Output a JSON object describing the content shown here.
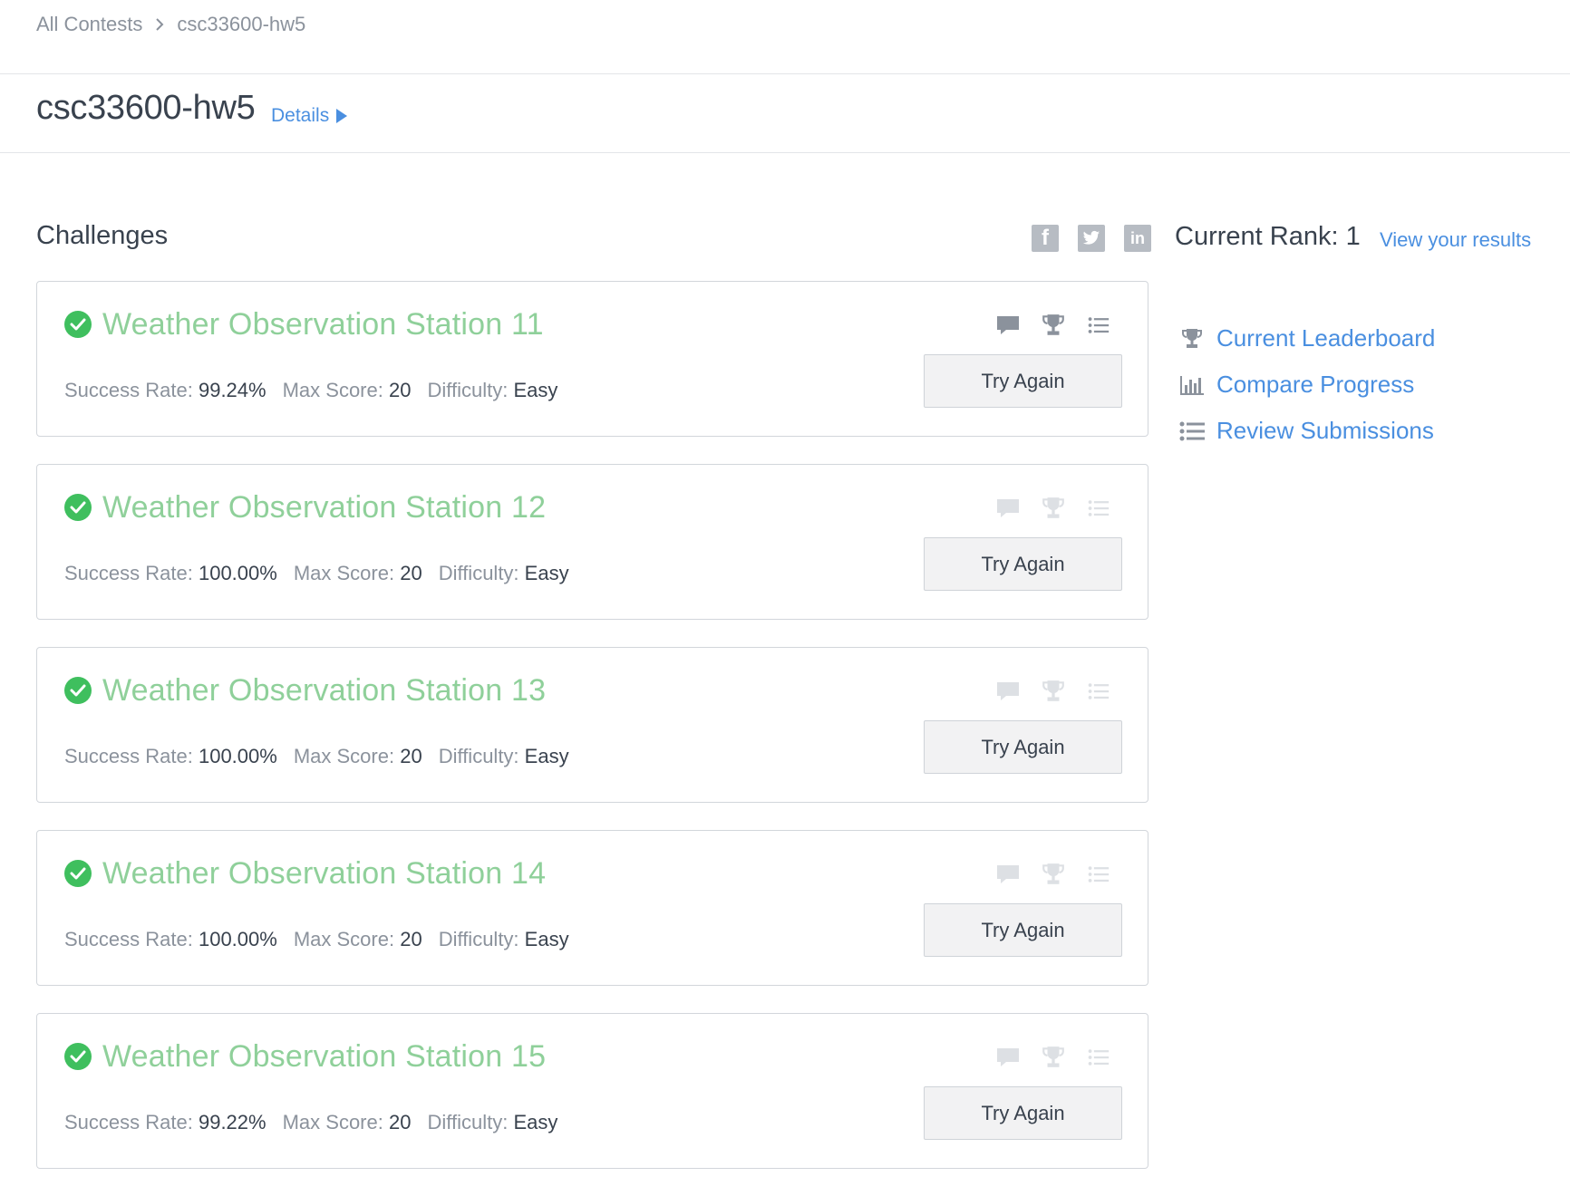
{
  "breadcrumb": {
    "root": "All Contests",
    "current": "csc33600-hw5"
  },
  "header": {
    "title": "csc33600-hw5",
    "details_label": "Details"
  },
  "challenges": {
    "heading": "Challenges",
    "rank_label": "Current Rank: 1",
    "view_results_label": "View your results",
    "items": [
      {
        "title": "Weather Observation Station 11",
        "success_label": "Success Rate:",
        "success_rate": "99.24%",
        "max_label": "Max Score:",
        "max_score": "20",
        "difficulty_label": "Difficulty:",
        "difficulty": "Easy",
        "button_label": "Try Again",
        "icons_active": true
      },
      {
        "title": "Weather Observation Station 12",
        "success_label": "Success Rate:",
        "success_rate": "100.00%",
        "max_label": "Max Score:",
        "max_score": "20",
        "difficulty_label": "Difficulty:",
        "difficulty": "Easy",
        "button_label": "Try Again",
        "icons_active": false
      },
      {
        "title": "Weather Observation Station 13",
        "success_label": "Success Rate:",
        "success_rate": "100.00%",
        "max_label": "Max Score:",
        "max_score": "20",
        "difficulty_label": "Difficulty:",
        "difficulty": "Easy",
        "button_label": "Try Again",
        "icons_active": false
      },
      {
        "title": "Weather Observation Station 14",
        "success_label": "Success Rate:",
        "success_rate": "100.00%",
        "max_label": "Max Score:",
        "max_score": "20",
        "difficulty_label": "Difficulty:",
        "difficulty": "Easy",
        "button_label": "Try Again",
        "icons_active": false
      },
      {
        "title": "Weather Observation Station 15",
        "success_label": "Success Rate:",
        "success_rate": "99.22%",
        "max_label": "Max Score:",
        "max_score": "20",
        "difficulty_label": "Difficulty:",
        "difficulty": "Easy",
        "button_label": "Try Again",
        "icons_active": false
      }
    ]
  },
  "sidebar": {
    "links": [
      {
        "label": "Current Leaderboard",
        "icon": "trophy-icon"
      },
      {
        "label": "Compare Progress",
        "icon": "bar-chart-icon"
      },
      {
        "label": "Review Submissions",
        "icon": "list-icon"
      }
    ]
  },
  "social": {
    "icons": [
      "facebook-icon",
      "twitter-icon",
      "linkedin-icon"
    ],
    "facebook_glyph": "f",
    "linkedin_glyph": "in"
  },
  "colors": {
    "link": "#4a8fe0",
    "solved_title": "#8fd09a",
    "check": "#3fbf5e",
    "icon_active": "#8b929c",
    "icon_inactive": "#dde0e4",
    "social_bg": "#b7bcc3"
  }
}
